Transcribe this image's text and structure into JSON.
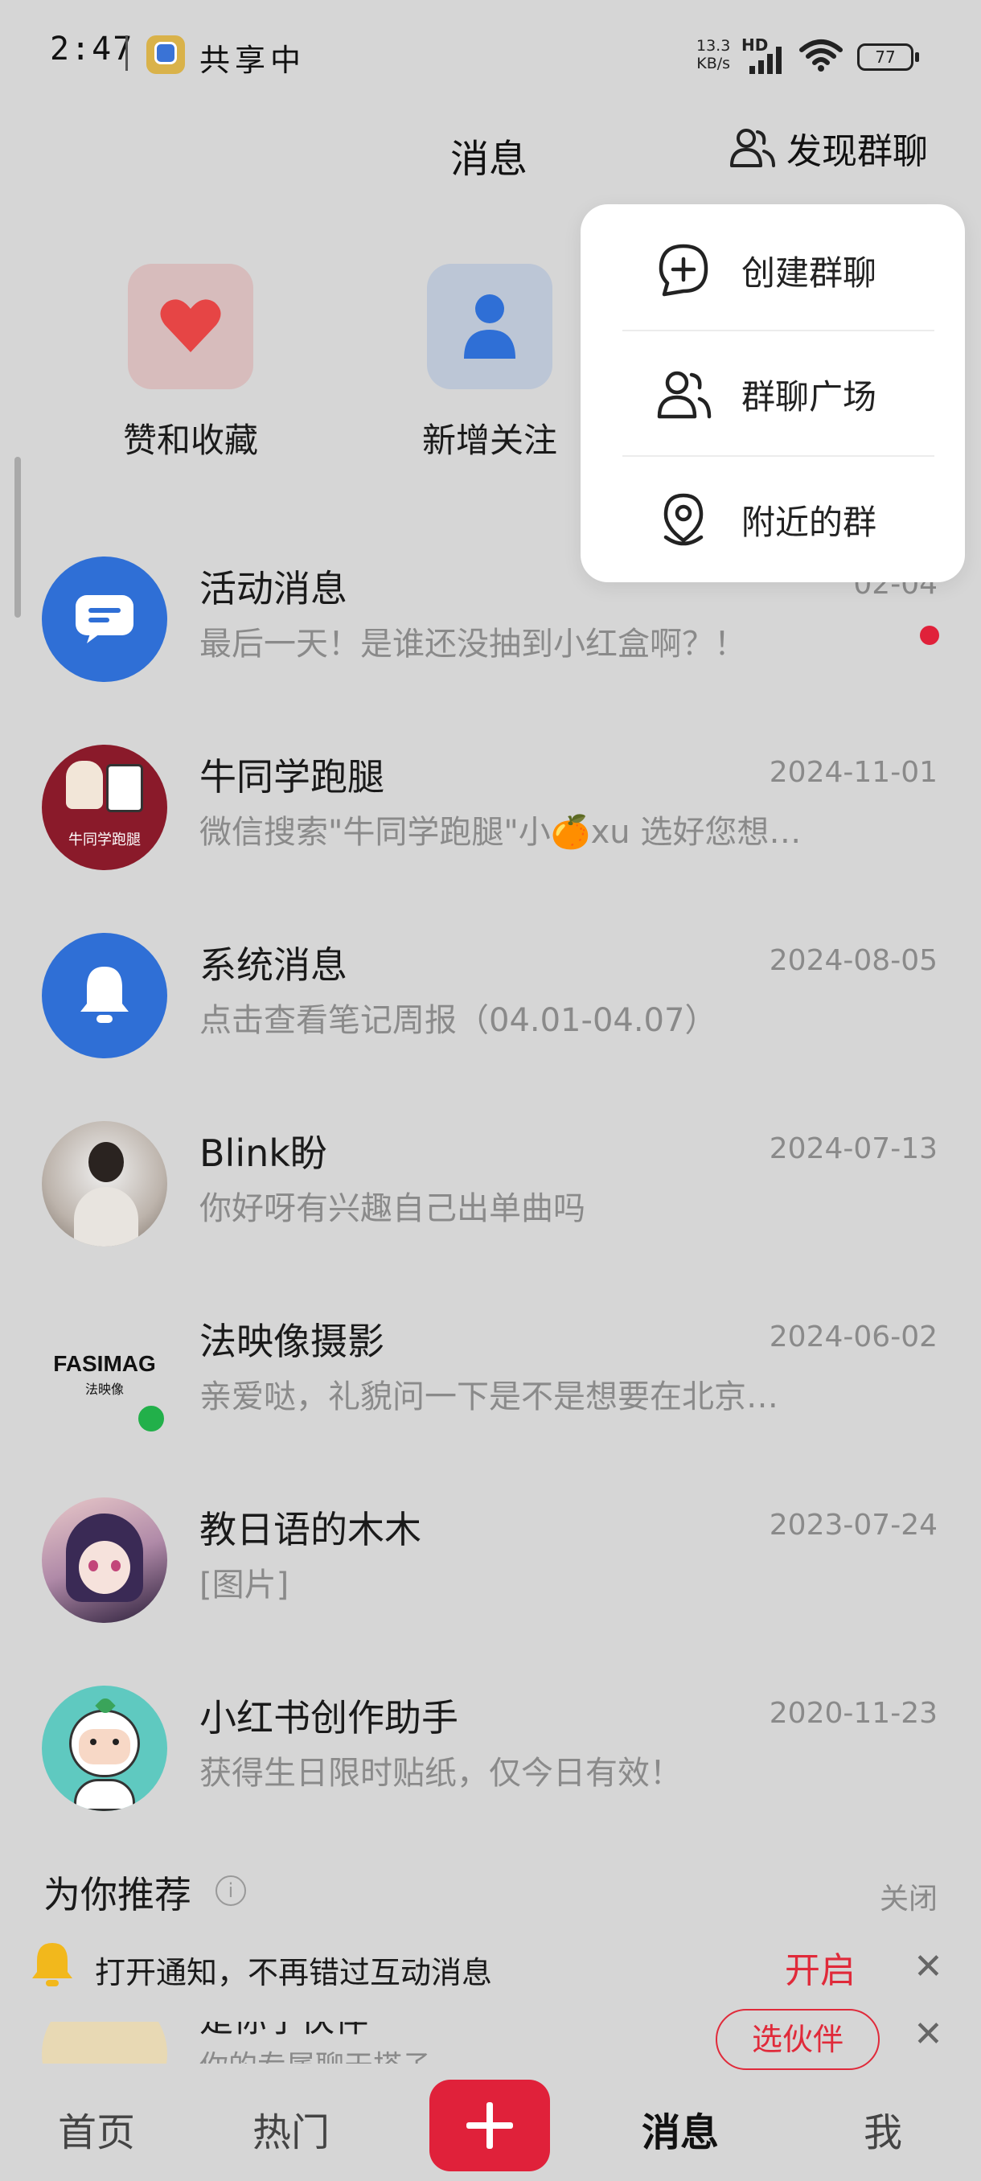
{
  "status_bar": {
    "time": "2:47",
    "app_status": "共享中",
    "net_speed_value": "13.3",
    "net_speed_unit": "KB/s",
    "network_badge": "HD",
    "battery": "77"
  },
  "header": {
    "title": "消息",
    "discover_label": "发现群聊"
  },
  "shortcuts": [
    {
      "label": "赞和收藏",
      "icon": "heart-icon",
      "color": "#e64545"
    },
    {
      "label": "新增关注",
      "icon": "person-icon",
      "color": "#2f6fd6"
    }
  ],
  "popup_menu": [
    {
      "label": "创建群聊",
      "icon": "chat-plus-icon"
    },
    {
      "label": "群聊广场",
      "icon": "group-icon"
    },
    {
      "label": "附近的群",
      "icon": "location-pin-icon"
    }
  ],
  "messages": [
    {
      "title": "活动消息",
      "date": "02-04",
      "subtitle": "最后一天！是谁还没抽到小红盒啊？！",
      "unread": true
    },
    {
      "title": "牛同学跑腿",
      "date": "2024-11-01",
      "subtitle": "微信搜索\"牛同学跑腿\"小🍊xu  选好您想…",
      "avatar_text": "牛同学跑腿"
    },
    {
      "title": "系统消息",
      "date": "2024-08-05",
      "subtitle": "点击查看笔记周报（04.01-04.07）"
    },
    {
      "title": "Blink盼",
      "date": "2024-07-13",
      "subtitle": "你好呀有兴趣自己出单曲吗"
    },
    {
      "title": "法映像摄影",
      "date": "2024-06-02",
      "subtitle": "亲爱哒，礼貌问一下是不是想要在北京…",
      "avatar_text": "FASIMAG",
      "avatar_subtext": "法映像",
      "online": true
    },
    {
      "title": "教日语的木木",
      "date": "2023-07-24",
      "subtitle": "[图片]"
    },
    {
      "title": "小红书创作助手",
      "date": "2020-11-23",
      "subtitle": "获得生日限时贴纸，仅今日有效！"
    }
  ],
  "recommend": {
    "title": "为你推荐",
    "info_glyph": "i",
    "close_label": "关闭",
    "item_name": "是你了伙伴",
    "item_desc": "你的专属聊天搭子",
    "pick_label": "选伙伴"
  },
  "notification": {
    "text": "打开通知，不再错过互动消息",
    "action_label": "开启",
    "close_glyph": "✕"
  },
  "bottom_nav": {
    "home": "首页",
    "hot": "热门",
    "messages": "消息",
    "me": "我"
  },
  "colors": {
    "accent": "#e0213a",
    "background": "#d6d6d6",
    "blue": "#2f6fd6",
    "online": "#22b04a"
  }
}
